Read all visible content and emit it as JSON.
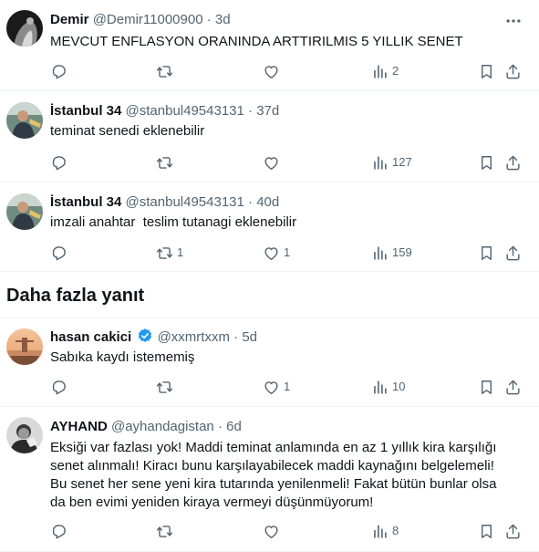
{
  "section_title": "Daha fazla yanıt",
  "tweets": [
    {
      "name": "Demir",
      "handle": "@Demir11000900",
      "time": "3d",
      "text": "MEVCUT ENFLASYON ORANINDA ARTTIRILMIS 5 YILLIK SENET",
      "replies": "",
      "retweets": "",
      "likes": "",
      "views": "2"
    },
    {
      "name": "İstanbul 34",
      "handle": "@stanbul49543131",
      "time": "37d",
      "text": "teminat senedi eklenebilir",
      "replies": "",
      "retweets": "",
      "likes": "",
      "views": "127"
    },
    {
      "name": "İstanbul 34",
      "handle": "@stanbul49543131",
      "time": "40d",
      "text": "imzali anahtar  teslim tutanagi eklenebilir",
      "replies": "",
      "retweets": "1",
      "likes": "1",
      "views": "159"
    },
    {
      "name": "hasan cakici",
      "handle": "@xxmrtxxm",
      "time": "5d",
      "text": "Sabıka kaydı istememiş",
      "replies": "",
      "retweets": "",
      "likes": "1",
      "views": "10"
    },
    {
      "name": "AYHAND",
      "handle": "@ayhandagistan",
      "time": "6d",
      "text": "Eksiği var fazlası yok! Maddi teminat anlamında en az 1 yıllık kira karşılığı senet alınmalı! Kiracı bunu karşılayabilecek maddi kaynağını belgelemeli! Bu senet her sene yeni kira tutarında yenilenmeli! Fakat bütün bunlar olsa da ben evimi yeniden kiraya vermeyi düşünmüyorum!",
      "replies": "",
      "retweets": "",
      "likes": "",
      "views": "8"
    }
  ],
  "separator": " · ",
  "colors": {
    "text": "#0f1419",
    "secondary": "#536471",
    "verified": "#1d9bf0",
    "border": "#eff3f4"
  },
  "icons": {
    "more": "more-icon",
    "reply": "reply-icon",
    "retweet": "retweet-icon",
    "like": "heart-icon",
    "views": "views-icon",
    "bookmark": "bookmark-icon",
    "share": "share-icon",
    "verified": "verified-badge-icon"
  }
}
